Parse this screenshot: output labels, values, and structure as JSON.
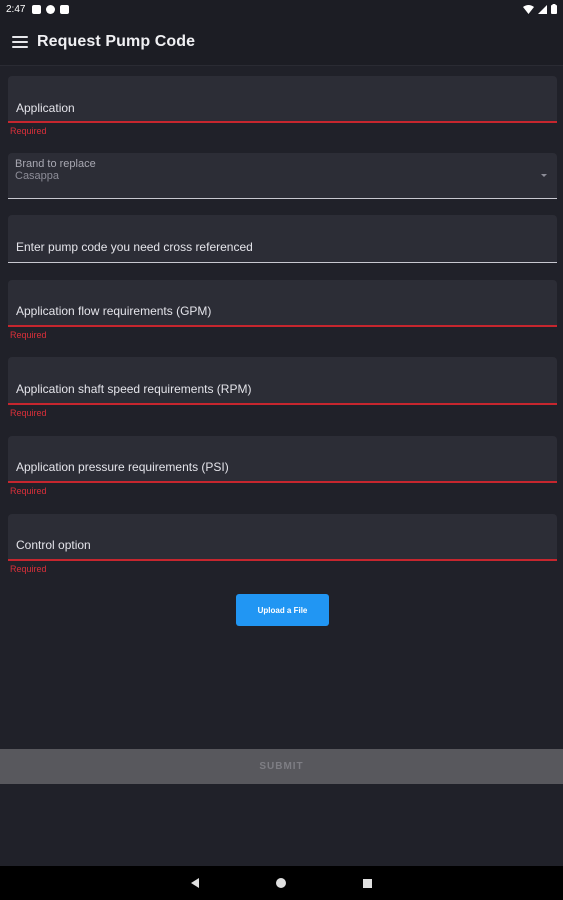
{
  "status_bar": {
    "time": "2:47",
    "left_icons": [
      "notification-icon",
      "app-icon",
      "sd-card-icon"
    ],
    "right_icons": [
      "wifi-icon",
      "signal-icon",
      "battery-icon"
    ]
  },
  "app_bar": {
    "menu_icon": "hamburger-menu-icon",
    "title": "Request Pump Code"
  },
  "form": {
    "application": {
      "label": "Application",
      "helper": "Required"
    },
    "brand": {
      "label": "Brand to replace",
      "value": "Casappa",
      "caret_icon": "dropdown-arrow-icon"
    },
    "pump_code": {
      "label": "Enter pump code you need cross referenced"
    },
    "flow": {
      "label": "Application flow requirements (GPM)",
      "helper": "Required"
    },
    "shaft_speed": {
      "label": "Application shaft speed requirements (RPM)",
      "helper": "Required"
    },
    "pressure": {
      "label": "Application pressure requirements (PSI)",
      "helper": "Required"
    },
    "control": {
      "label": "Control option",
      "helper": "Required"
    },
    "upload_label": "Upload a File",
    "submit_label": "SUBMIT"
  },
  "colors": {
    "background": "#202129",
    "field_fill": "#2c2d36",
    "error": "#c6262e",
    "accent": "#2196f3",
    "submit_bar": "#58585d"
  },
  "nav_bar": {
    "icons": [
      "back-icon",
      "home-icon",
      "recents-icon"
    ]
  }
}
